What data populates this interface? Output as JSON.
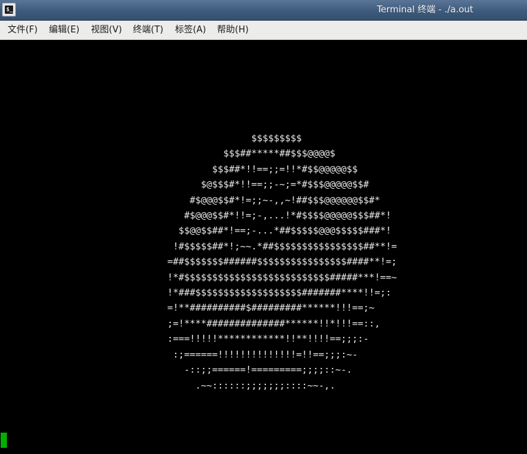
{
  "window": {
    "title": "Terminal 终端 - ./a.out",
    "icon": "terminal-icon"
  },
  "menu": {
    "items": [
      {
        "label": "文件(F)"
      },
      {
        "label": "编辑(E)"
      },
      {
        "label": "视图(V)"
      },
      {
        "label": "终端(T)"
      },
      {
        "label": "标签(A)"
      },
      {
        "label": "帮助(H)"
      }
    ]
  },
  "terminal": {
    "output_lines": [
      "",
      "",
      "",
      "                      $$$$$$$$$",
      "                 $$$##*****##$$$@@@@$",
      "               $$$##*!!==;;=!!*#$$@@@@@$$",
      "             $@$$$#*!!==;;-~;=*#$$$@@@@@$$#",
      "           #$@@@$$#*!=;;~-,,~!##$$$@@@@@@$$#*",
      "          #$@@@$$#*!!=;-,...!*#$$$$@@@@@$$$##*!",
      "         $$@@$$##*!==;-...*##$$$$$@@@$$$$$###*!",
      "        !#$$$$$##*!;~~.*##$$$$$$$$$$$$$$$$##**!=",
      "       =##$$$$$$$######$$$$$$$$$$$$$$$$####**!=;",
      "       !*#$$$$$$$$$$$$$$$$$$$$$$$$$$#####***!==~",
      "       !*###$$$$$$$$$$$$$$$$$$$#######****!!=;:",
      "       =!**##########$#########******!!!==;~",
      "       ;=!****##############******!!*!!!==::,",
      "       :===!!!!!************!!**!!!!==;;;:-",
      "        :;======!!!!!!!!!!!!!!=!!==;;;:~-",
      "          -::;;======!=========;;;;::~-.",
      "            .~~::::::;;;;;;;::::~~-,."
    ]
  },
  "colors": {
    "titlebar": "#3e5a7d",
    "menubar": "#ececea",
    "terminal_bg": "#000000",
    "terminal_fg": "#e9e9e9",
    "cursor": "#00b000"
  }
}
